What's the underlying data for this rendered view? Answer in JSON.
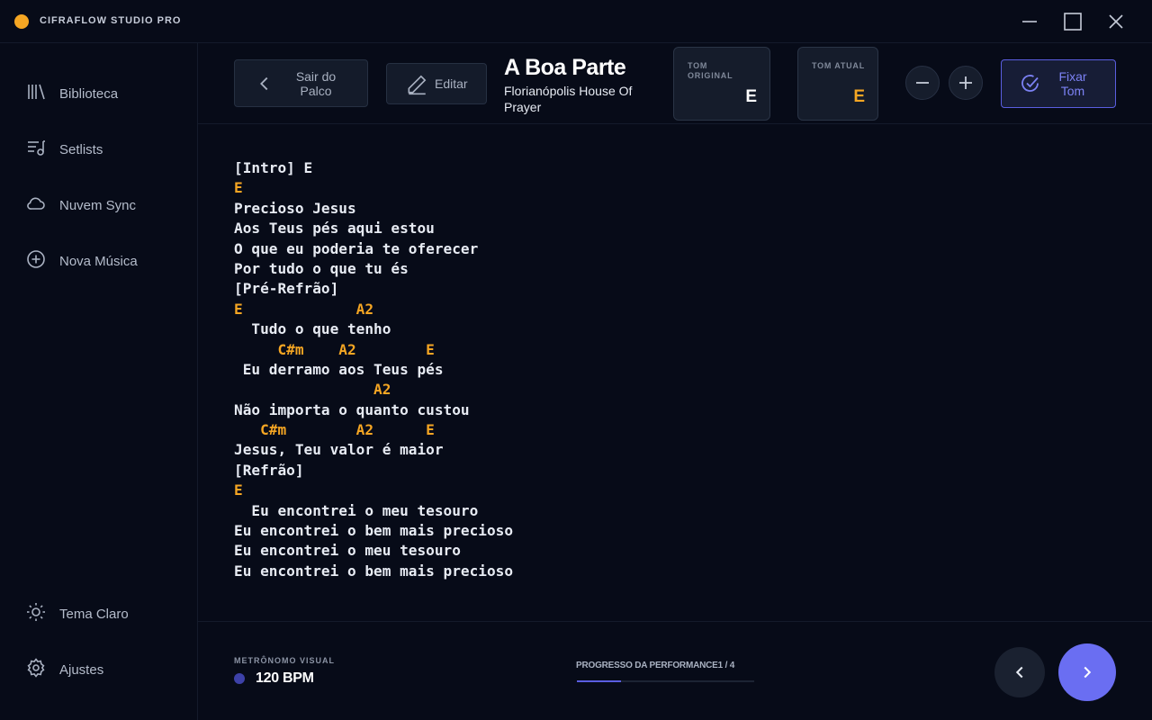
{
  "app": {
    "title": "CIFRAFLOW STUDIO PRO",
    "accent": "#f5a623",
    "brand": "#6a6ef2"
  },
  "window_controls": [
    "minimize-icon",
    "maximize-icon",
    "close-icon"
  ],
  "sidebar": {
    "top_items": [
      {
        "label": "Biblioteca",
        "icon": "library-icon"
      },
      {
        "label": "Setlists",
        "icon": "setlist-icon"
      },
      {
        "label": "Nuvem Sync",
        "icon": "cloud-icon"
      },
      {
        "label": "Nova Música",
        "icon": "plus-circle-icon"
      }
    ],
    "bottom_items": [
      {
        "label": "Tema Claro",
        "icon": "sun-icon"
      },
      {
        "label": "Ajustes",
        "icon": "gear-icon"
      }
    ]
  },
  "header": {
    "back_label": "Sair do Palco",
    "edit_label": "Editar",
    "song_title": "A Boa Parte",
    "song_artist": "Florianópolis House Of Prayer",
    "original_key_label": "TOM ORIGINAL",
    "original_key": "E",
    "current_key_label": "TOM ATUAL",
    "current_key": "E",
    "fix_key_label": "Fixar Tom"
  },
  "sheet": [
    {
      "type": "section",
      "text": "[Intro] E"
    },
    {
      "type": "chord",
      "text": "E"
    },
    {
      "type": "lyric",
      "text": "Precioso Jesus"
    },
    {
      "type": "lyric",
      "text": "Aos Teus pés aqui estou"
    },
    {
      "type": "lyric",
      "text": "O que eu poderia te oferecer"
    },
    {
      "type": "lyric",
      "text": "Por tudo o que tu és"
    },
    {
      "type": "section",
      "text": "[Pré-Refrão]"
    },
    {
      "type": "chord",
      "text": "E             A2"
    },
    {
      "type": "lyric",
      "text": "  Tudo o que tenho"
    },
    {
      "type": "chord",
      "text": "     C#m    A2        E"
    },
    {
      "type": "lyric",
      "text": " Eu derramo aos Teus pés"
    },
    {
      "type": "chord",
      "text": "                A2"
    },
    {
      "type": "lyric",
      "text": "Não importa o quanto custou"
    },
    {
      "type": "chord",
      "text": "   C#m        A2      E"
    },
    {
      "type": "lyric",
      "text": "Jesus, Teu valor é maior"
    },
    {
      "type": "section",
      "text": "[Refrão]"
    },
    {
      "type": "chord",
      "text": "E"
    },
    {
      "type": "lyric",
      "text": "  Eu encontrei o meu tesouro"
    },
    {
      "type": "lyric",
      "text": "Eu encontrei o bem mais precioso"
    },
    {
      "type": "lyric",
      "text": "Eu encontrei o meu tesouro"
    },
    {
      "type": "lyric",
      "text": "Eu encontrei o bem mais precioso"
    }
  ],
  "footer": {
    "metronome_label": "METRÔNOMO VISUAL",
    "bpm": "120 BPM",
    "progress_label": "PROGRESSO DA PERFORMANCE",
    "progress_count": "1 / 4",
    "progress_fraction": 0.25
  }
}
